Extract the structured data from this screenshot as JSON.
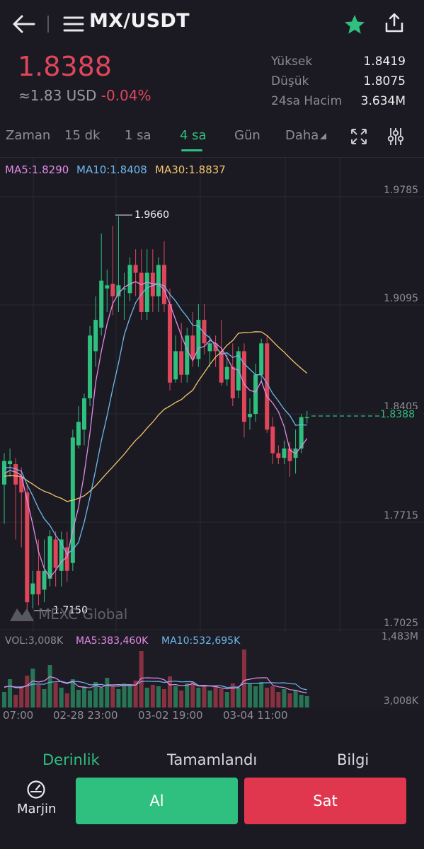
{
  "header": {
    "pair": "MX/USDT"
  },
  "price": {
    "last": "1.8388",
    "usd": "≈1.83 USD",
    "change": "-0.04%",
    "stats": [
      {
        "label": "Yüksek",
        "value": "1.8419"
      },
      {
        "label": "Düşük",
        "value": "1.8075"
      },
      {
        "label": "24sa Hacim",
        "value": "3.634M"
      }
    ]
  },
  "tabs": [
    {
      "label": "Zaman"
    },
    {
      "label": "15 dk"
    },
    {
      "label": "1 sa"
    },
    {
      "label": "4 sa",
      "active": true
    },
    {
      "label": "Gün"
    },
    {
      "label": "Daha"
    }
  ],
  "chart": {
    "ma_legend": {
      "ma5": "MA5:1.8290",
      "ma10": "MA10:1.8408",
      "ma30": "MA30:1.8837"
    },
    "y_ticks": [
      "1.9785",
      "1.9095",
      "1.8405",
      "1.7715",
      "1.7025"
    ],
    "current_price_label": "1.8388",
    "high_marker": "1.9660",
    "low_marker": "1.7150",
    "watermark": "MEXC Global",
    "vol_legend": {
      "vol": "VOL:3,008K",
      "ma5": "MA5:383,460K",
      "ma10": "MA10:532,695K"
    },
    "vol_max": "1,483M",
    "vol_min": "3,008K",
    "x_ticks": [
      "07:00",
      "02-28 23:00",
      "03-02 19:00",
      "03-04 11:00"
    ],
    "colors": {
      "up": "#2fbf7f",
      "down": "#e0465a",
      "ma5": "#e38ae8",
      "ma10": "#6db8ee",
      "ma30": "#f2c46d"
    }
  },
  "bottom_tabs": [
    {
      "label": "Derinlik",
      "active": true
    },
    {
      "label": "Tamamlandı"
    },
    {
      "label": "Bilgi"
    }
  ],
  "actions": {
    "margin_label": "Marjin",
    "buy_label": "Al",
    "sell_label": "Sat"
  }
}
